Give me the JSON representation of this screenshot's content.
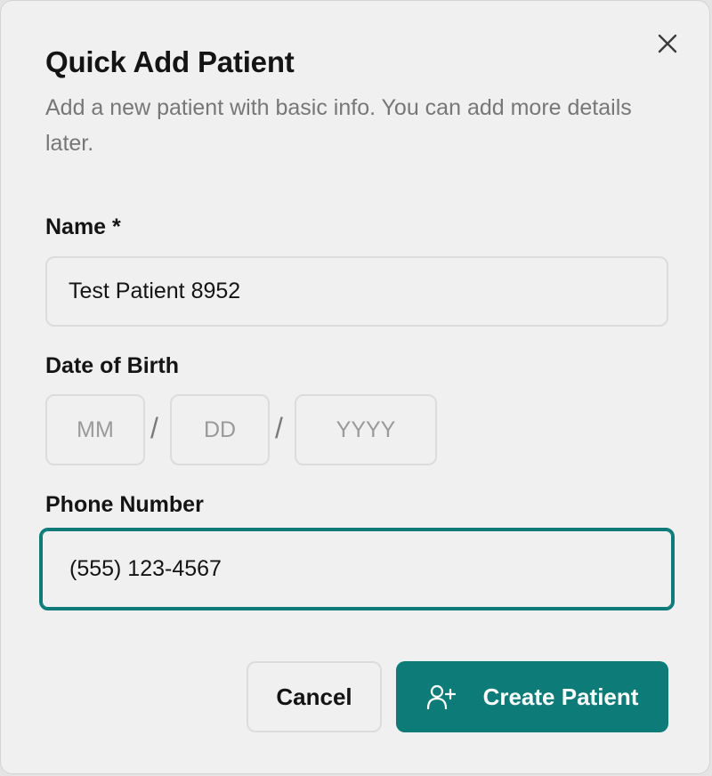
{
  "dialog": {
    "title": "Quick Add Patient",
    "subtitle": "Add a new patient with basic info. You can add more details later.",
    "close_icon": "close-icon"
  },
  "form": {
    "name": {
      "label": "Name *",
      "value": "Test Patient 8952"
    },
    "dob": {
      "label": "Date of Birth",
      "month_placeholder": "MM",
      "day_placeholder": "DD",
      "year_placeholder": "YYYY",
      "separator": "/"
    },
    "phone": {
      "label": "Phone Number",
      "value": "(555) 123-4567"
    }
  },
  "actions": {
    "cancel_label": "Cancel",
    "create_label": "Create Patient",
    "create_icon": "user-plus-icon"
  },
  "colors": {
    "accent": "#0d7c78",
    "background": "#f0f0f0",
    "border": "#dcdcdc",
    "muted_text": "#777777"
  }
}
